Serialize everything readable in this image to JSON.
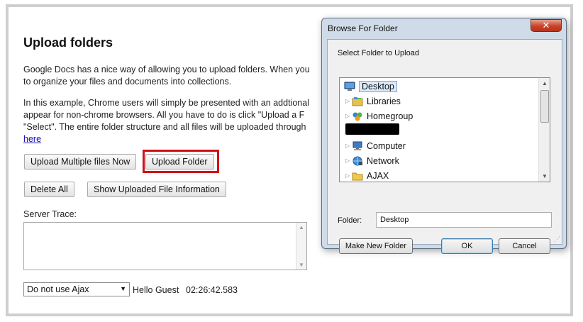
{
  "page": {
    "title": "Upload folders",
    "para1_line1": "Google Docs has a nice way of allowing you to upload folders. When you",
    "para1_line2": "to organize your files and documents into collections.",
    "para2_line1": "In this example, Chrome users will simply be presented with an addtional",
    "para2_line2": "appear for non-chrome browsers. All you have to do is click \"Upload a F",
    "para2_line3": "\"Select\". The entire folder structure and all files will be uploaded through",
    "link_text": "here",
    "upload_multiple_label": "Upload Multiple files Now",
    "upload_folder_label": "Upload Folder",
    "delete_all_label": "Delete All",
    "show_info_label": "Show Uploaded File Information",
    "server_trace_label": "Server Trace:",
    "ajax_select_value": "Do not use Ajax",
    "greeting": "Hello Guest",
    "timestamp": "02:26:42.583",
    "highlight_color": "#d0101a"
  },
  "dialog": {
    "title": "Browse For Folder",
    "close_glyph": "✕",
    "prompt": "Select Folder to Upload",
    "tree": [
      {
        "label": "Desktop",
        "icon": "desktop-icon",
        "selected": true,
        "expandable": false
      },
      {
        "label": "Libraries",
        "icon": "libraries-icon",
        "selected": false,
        "expandable": true
      },
      {
        "label": "Homegroup",
        "icon": "homegroup-icon",
        "selected": false,
        "expandable": true
      },
      {
        "label": "Computer",
        "icon": "computer-icon",
        "selected": false,
        "expandable": true
      },
      {
        "label": "Network",
        "icon": "network-icon",
        "selected": false,
        "expandable": true
      },
      {
        "label": "AJAX",
        "icon": "folder-icon",
        "selected": false,
        "expandable": true
      }
    ],
    "folder_label": "Folder:",
    "folder_value": "Desktop",
    "make_new_folder_label": "Make New Folder",
    "ok_label": "OK",
    "cancel_label": "Cancel"
  }
}
